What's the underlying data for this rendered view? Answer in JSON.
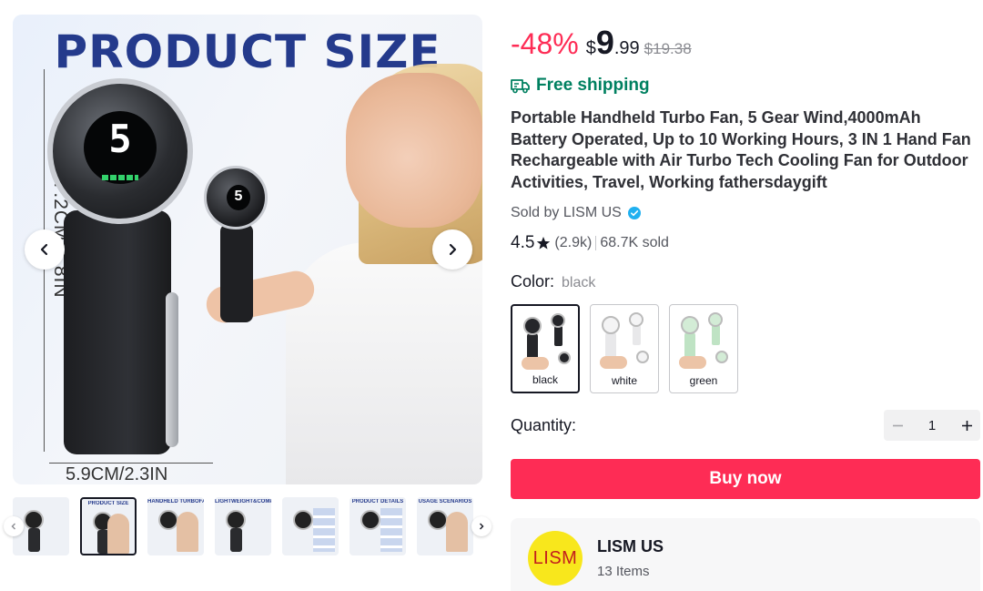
{
  "gallery": {
    "headline": "PRODUCT SIZE",
    "dimension_vertical": "17.2CM/6.8IN",
    "dimension_horizontal": "5.9CM/2.3IN",
    "fan_display_digit": "5",
    "prev_icon": "chevron-left-icon",
    "next_icon": "chevron-right-icon",
    "thumbnails": [
      {
        "label": "",
        "kind": "fan"
      },
      {
        "label": "PRODUCT SIZE",
        "kind": "person",
        "selected": true
      },
      {
        "label": "HANDHELD TURBOFAN",
        "kind": "person"
      },
      {
        "label": "LIGHTWEIGHT&COMPACT",
        "kind": "fan"
      },
      {
        "label": "",
        "kind": "panel"
      },
      {
        "label": "PRODUCT DETAILS",
        "kind": "panel"
      },
      {
        "label": "USAGE SCENARIOS",
        "kind": "person"
      }
    ]
  },
  "price": {
    "discount": "-48%",
    "currency": "$",
    "integer": "9",
    "decimal": ".99",
    "original": "$19.38"
  },
  "shipping": {
    "label": "Free shipping",
    "icon": "truck-icon",
    "color": "#008060"
  },
  "product": {
    "title": "Portable Handheld Turbo Fan, 5 Gear Wind,4000mAh Battery Operated, Up to 10 Working Hours, 3 IN 1 Hand Fan Rechargeable with Air Turbo Tech Cooling Fan for Outdoor Activities, Travel, Working fathersdaygift",
    "seller": "Sold by LISM US",
    "rating": "4.5",
    "review_count": "(2.9k)",
    "sold": "68.7K sold"
  },
  "color": {
    "label": "Color:",
    "selected_value": "black",
    "options": [
      {
        "name": "black",
        "body_color": "#25262a",
        "selected": true
      },
      {
        "name": "white",
        "body_color": "#e8e8ea",
        "selected": false
      },
      {
        "name": "green",
        "body_color": "#bfe3c4",
        "selected": false
      }
    ]
  },
  "quantity": {
    "label": "Quantity:",
    "value": "1"
  },
  "buy_button": {
    "label": "Buy now",
    "color": "#fe2c55"
  },
  "shop": {
    "logo_text": "LISM",
    "name": "LISM US",
    "items": "13 Items"
  }
}
